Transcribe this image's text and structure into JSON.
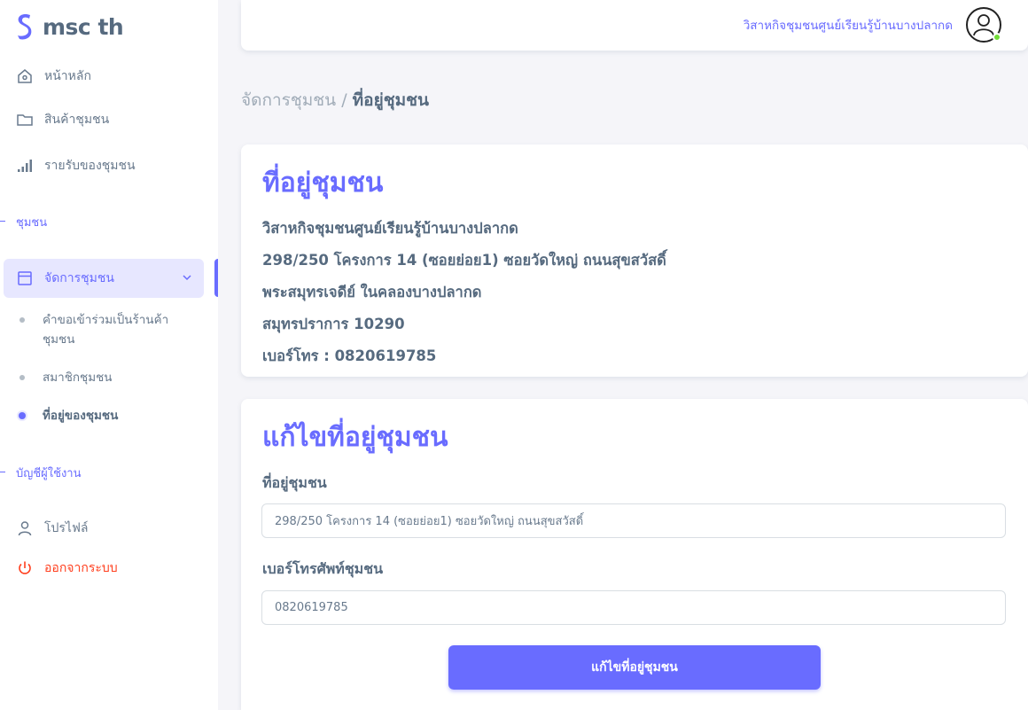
{
  "brand": {
    "name": "msc th"
  },
  "sidebar": {
    "items": [
      {
        "label": "หน้าหลัก",
        "icon": "home-icon"
      },
      {
        "label": "สินค้าชุมชน",
        "icon": "folder-icon"
      },
      {
        "label": "รายรับของชุมชน",
        "icon": "bar-chart-icon"
      }
    ],
    "section_community": "ชุมชน",
    "manage": {
      "label": "จัดการชุมชน",
      "icon": "layout-icon"
    },
    "sub_items": [
      {
        "label": "คำขอเข้าร่วมเป็นร้านค้าชุมชน"
      },
      {
        "label": "สมาชิกชุมชน"
      },
      {
        "label": "ที่อยู่ของชุมชน"
      }
    ],
    "section_account": "บัญชีผู้ใช้งาน",
    "profile": {
      "label": "โปรไฟล์",
      "icon": "user-icon"
    },
    "logout": {
      "label": "ออกจากระบบ",
      "icon": "power-icon"
    }
  },
  "navbar": {
    "community_name": "วิสาหกิจชุมชนศูนย์เรียนรู้บ้านบางปลากด"
  },
  "breadcrumb": {
    "parent": "จัดการชุมชน",
    "separator": " / ",
    "current": "ที่อยู่ชุมชน"
  },
  "address_card": {
    "title": "ที่อยู่ชุมชน",
    "lines": [
      "วิสาหกิจชุมชนศูนย์เรียนรู้บ้านบางปลากด",
      "298/250 โครงการ 14 (ซอยย่อย1) ซอยวัดใหญ่ ถนนสุขสวัสดิ์",
      "พระสมุทรเจดีย์ ในคลองบางปลากด",
      "สมุทรปราการ 10290",
      "เบอร์โทร : 0820619785"
    ]
  },
  "edit_card": {
    "title": "แก้ไขที่อยู่ชุมชน",
    "address_label": "ที่อยู่ชุมชน",
    "address_value": "298/250 โครงการ 14 (ซอยย่อย1) ซอยวัดใหญ่ ถนนสุขสวัสดิ์",
    "phone_label": "เบอร์โทรศัพท์ชุมชน",
    "phone_value": "0820619785",
    "submit_label": "แก้ไขที่อยู่ชุมชน"
  },
  "colors": {
    "primary": "#696cff",
    "online": "#71dd37",
    "danger": "#ff3e1d"
  }
}
